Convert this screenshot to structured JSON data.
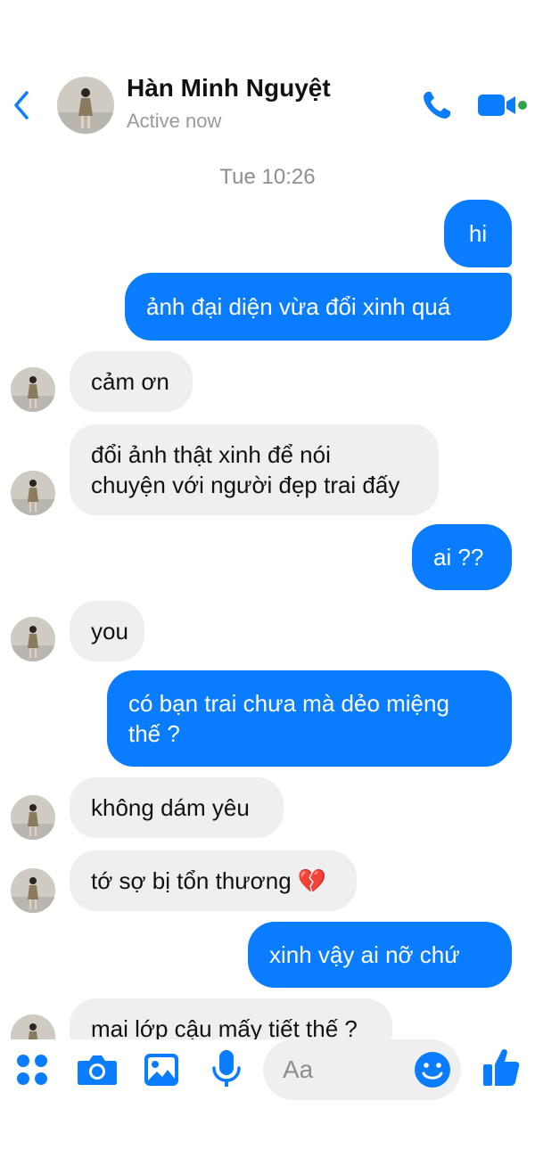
{
  "header": {
    "contact_name": "Hàn Minh Nguyệt",
    "status": "Active now"
  },
  "conversation": {
    "timestamp": "Tue 10:26",
    "messages": [
      {
        "direction": "out",
        "lines": [
          "hi"
        ]
      },
      {
        "direction": "out",
        "lines": [
          "ảnh đại diện vừa đổi xinh quá"
        ]
      },
      {
        "direction": "in",
        "lines": [
          "cảm ơn"
        ]
      },
      {
        "direction": "in",
        "lines": [
          "đổi ảnh thật xinh để nói",
          "chuyện với người đẹp trai đấy"
        ]
      },
      {
        "direction": "out",
        "lines": [
          "ai ??"
        ]
      },
      {
        "direction": "in",
        "lines": [
          "you"
        ]
      },
      {
        "direction": "out",
        "lines": [
          "có bạn trai chưa mà dẻo miệng",
          "thế ?"
        ]
      },
      {
        "direction": "in",
        "lines": [
          "không dám yêu"
        ]
      },
      {
        "direction": "in",
        "lines": [
          "tớ sợ bị tổn thương 💔"
        ]
      },
      {
        "direction": "out",
        "lines": [
          "xinh vậy ai nỡ chứ"
        ]
      },
      {
        "direction": "in",
        "lines": [
          "mai lớp cậu mấy tiết thế ?"
        ]
      }
    ]
  },
  "composer": {
    "placeholder": "Aa"
  },
  "colors": {
    "accent": "#0a7cff",
    "incoming_bubble": "#efefef",
    "online_dot": "#31a24c"
  },
  "icons": [
    "back-chevron-icon",
    "phone-icon",
    "video-camera-icon",
    "menu-dots-icon",
    "camera-icon",
    "image-icon",
    "microphone-icon",
    "emoji-icon",
    "thumbs-up-icon"
  ]
}
